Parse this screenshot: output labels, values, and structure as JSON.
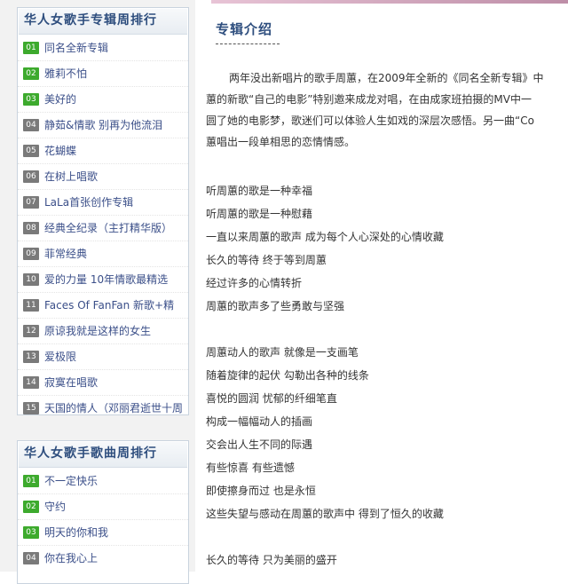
{
  "album_ranking": {
    "title": "华人女歌手专辑周排行",
    "items": [
      {
        "num": "01",
        "name": "同名全新专辑"
      },
      {
        "num": "02",
        "name": "雅莉不怕"
      },
      {
        "num": "03",
        "name": "美好的"
      },
      {
        "num": "04",
        "name": "静茹&情歌 别再为他流泪"
      },
      {
        "num": "05",
        "name": "花蝴蝶"
      },
      {
        "num": "06",
        "name": "在树上唱歌"
      },
      {
        "num": "07",
        "name": "LaLa首张创作专辑"
      },
      {
        "num": "08",
        "name": "经典全纪录（主打精华版）"
      },
      {
        "num": "09",
        "name": "菲常经典"
      },
      {
        "num": "10",
        "name": "爱的力量 10年情歌最精选"
      },
      {
        "num": "11",
        "name": "Faces Of FanFan 新歌+精"
      },
      {
        "num": "12",
        "name": "原谅我就是这样的女生"
      },
      {
        "num": "13",
        "name": "爱极限"
      },
      {
        "num": "14",
        "name": "寂寞在唱歌"
      },
      {
        "num": "15",
        "name": "天国的情人（邓丽君逝世十周"
      }
    ]
  },
  "song_ranking": {
    "title": "华人女歌手歌曲周排行",
    "items": [
      {
        "num": "01",
        "name": "不一定快乐"
      },
      {
        "num": "02",
        "name": "守约"
      },
      {
        "num": "03",
        "name": "明天的你和我"
      },
      {
        "num": "04",
        "name": "你在我心上"
      }
    ]
  },
  "main": {
    "section_title": "专辑介绍",
    "intro": [
      "两年没出新唱片的歌手周蕙，在2009年全新的《同名全新专辑》中",
      "蕙的新歌“自己的电影”特别邀来成龙对唱，在由成家班拍摄的MV中一",
      "圆了她的电影梦，歌迷们可以体验人生如戏的深层次感悟。另一曲“Co",
      "蕙唱出一段单相思的恋情情感。"
    ],
    "lyrics_stanza_1": [
      "听周蕙的歌是一种幸福",
      "听周蕙的歌是一种慰藉",
      "一直以来周蕙的歌声 成为每个人心深处的心情收藏",
      "长久的等待 终于等到周蕙",
      "经过许多的心情转折",
      "周蕙的歌声多了些勇敢与坚强"
    ],
    "lyrics_stanza_2": [
      "周蕙动人的歌声 就像是一支画笔",
      "随着旋律的起伏 勾勒出各种的线条",
      "喜悦的圆润 忧郁的纤细笔直",
      "构成一幅幅动人的插画",
      "交会出人生不同的际遇",
      "有些惊喜 有些遗憾",
      "即使擦身而过 也是永恒",
      "这些失望与感动在周蕙的歌声中 得到了恒久的收藏"
    ],
    "lyrics_stanza_3": [
      "长久的等待 只为美丽的盛开"
    ]
  }
}
